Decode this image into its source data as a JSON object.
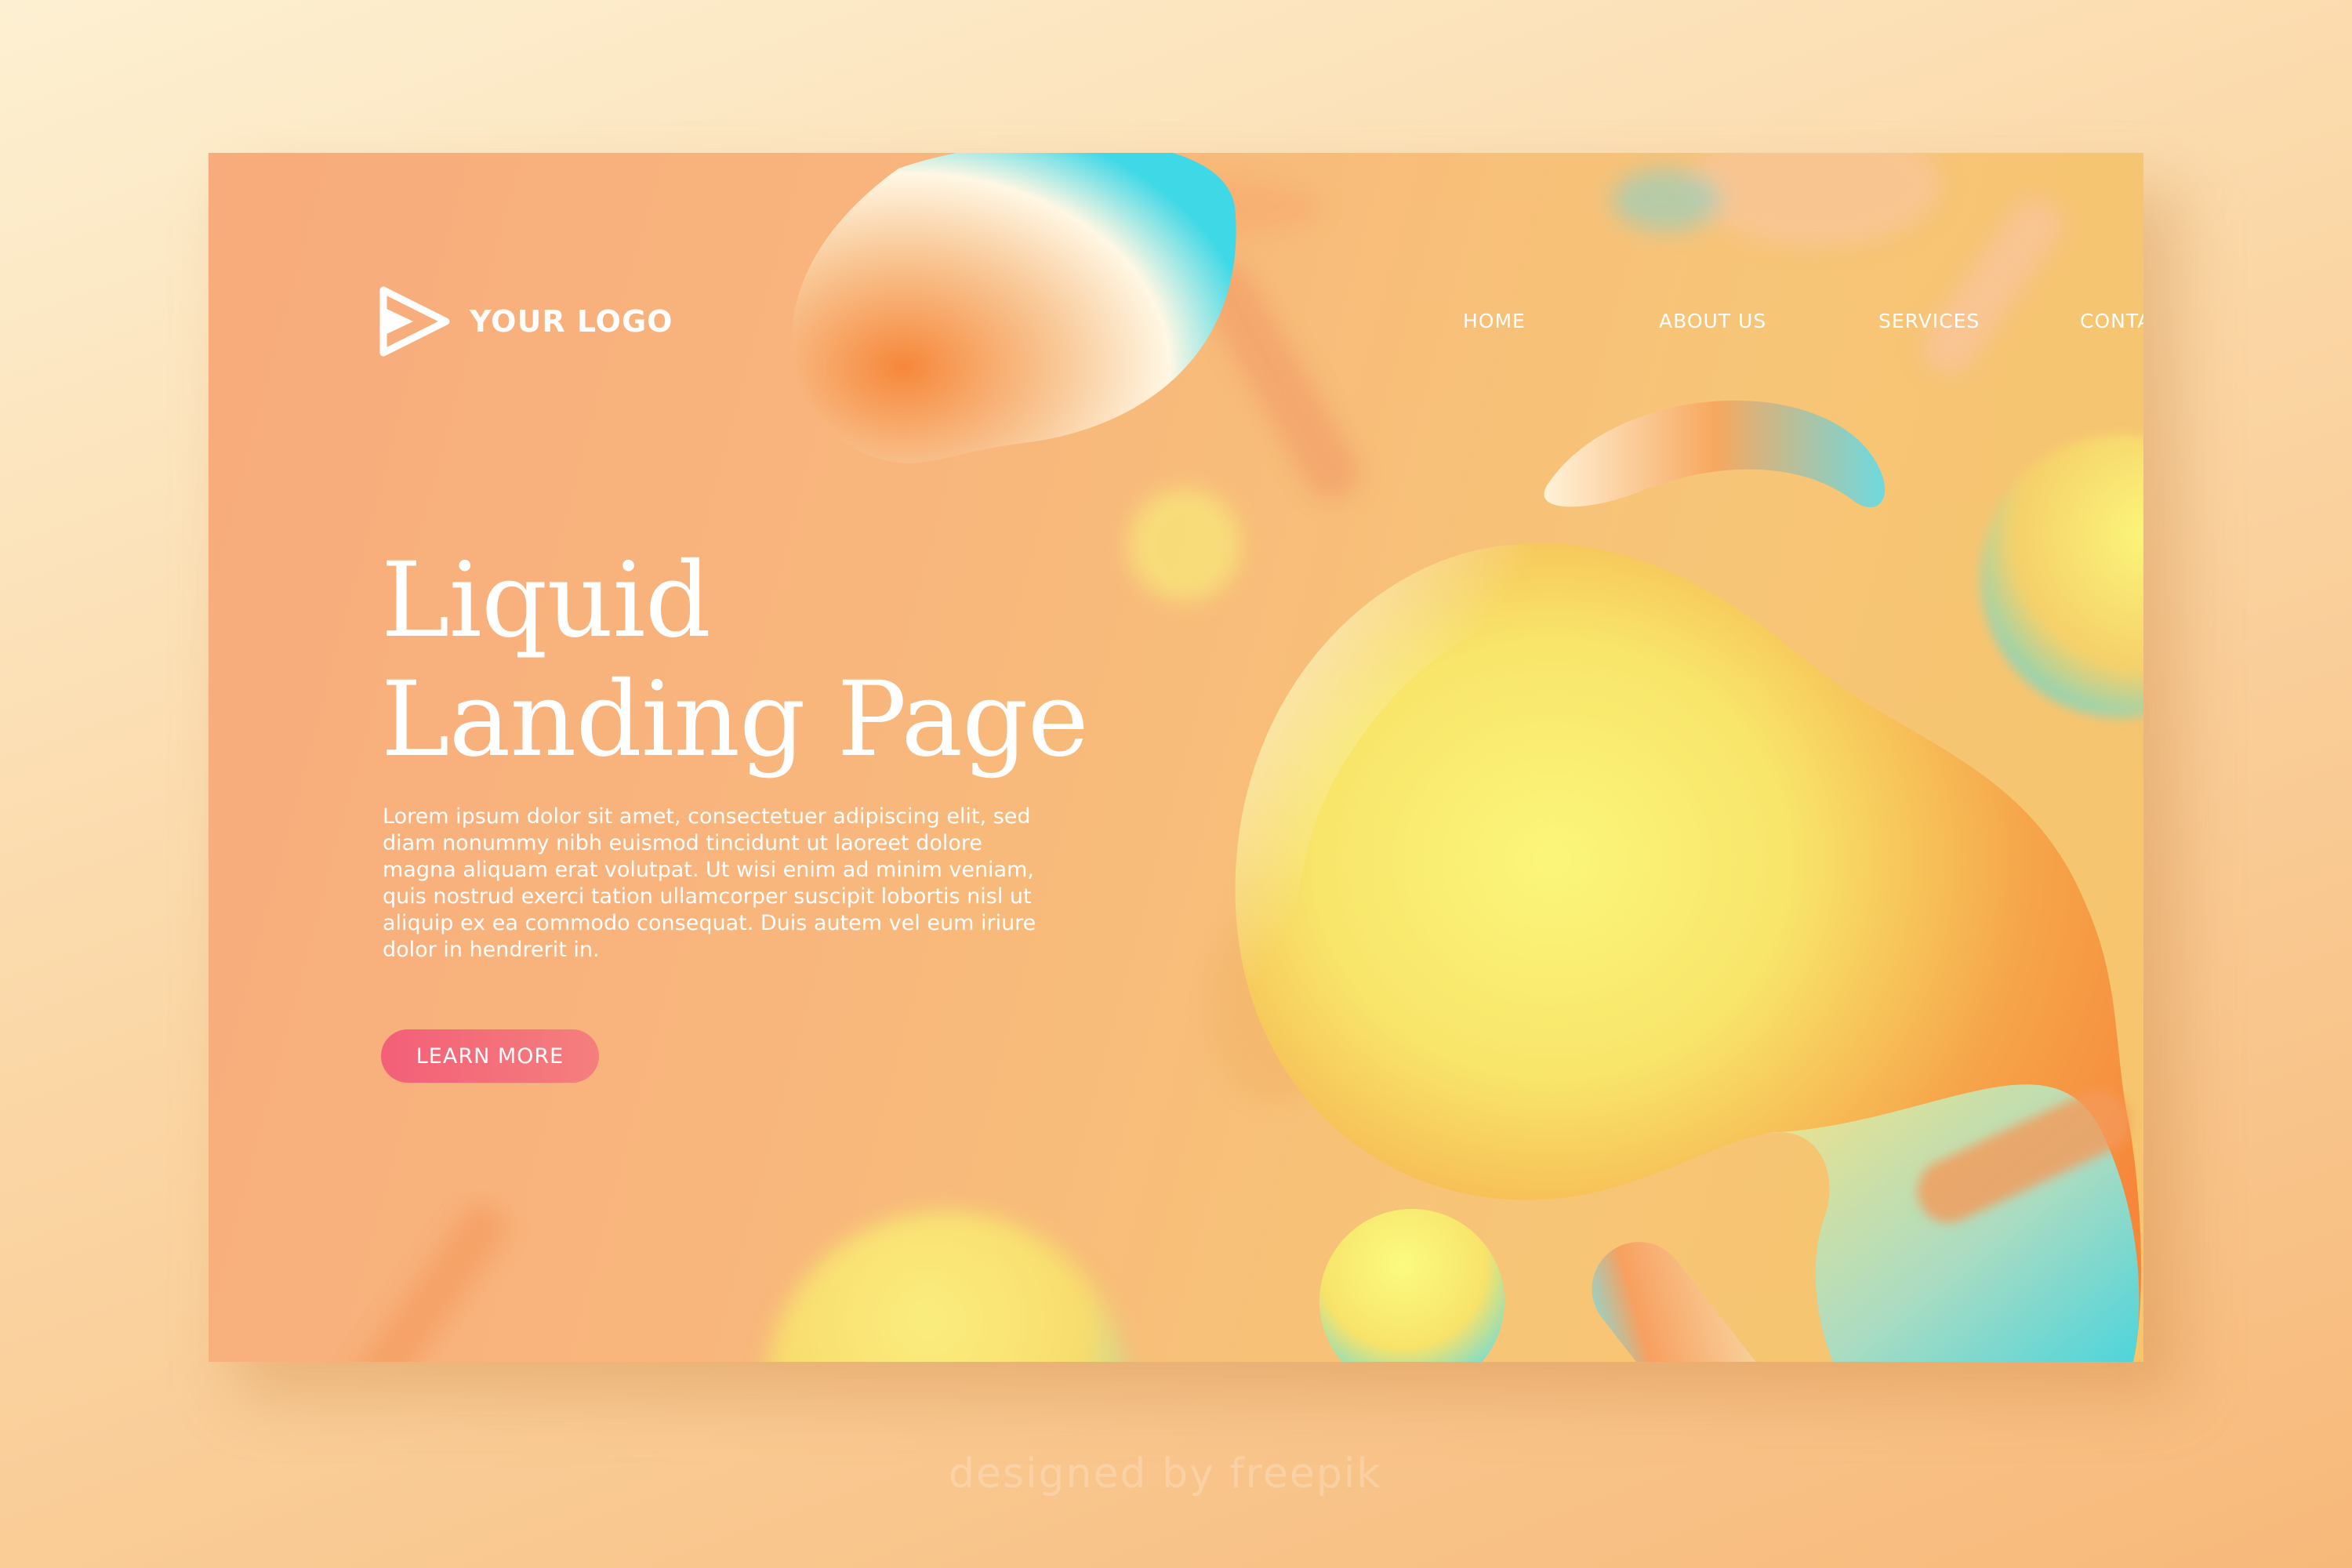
{
  "header": {
    "logo_text": "YOUR LOGO",
    "logo_icon": "play-icon",
    "nav": [
      {
        "label": "HOME"
      },
      {
        "label": "ABOUT US"
      },
      {
        "label": "SERVICES"
      },
      {
        "label": "CONTACT US"
      }
    ]
  },
  "hero": {
    "title_line1": "Liquid",
    "title_line2": "Landing Page",
    "body": "Lorem ipsum dolor sit amet, consectetuer adipiscing elit, sed diam nonummy nibh euismod tincidunt ut laoreet dolore magna aliquam erat volutpat. Ut wisi enim ad minim veniam, quis nostrud exerci tation ullamcorper suscipit lobortis nisl ut aliquip ex ea commodo consequat. Duis autem vel eum iriure dolor in hendrerit in.",
    "cta_label": "LEARN MORE"
  },
  "watermark": "designed by freepik",
  "colors": {
    "background": "#f8b67c",
    "accent_button": "#f35f78",
    "blob_yellow": "#fbf67a",
    "blob_orange": "#f6873a",
    "blob_cyan": "#3fd8e6",
    "text": "#ffffff"
  }
}
